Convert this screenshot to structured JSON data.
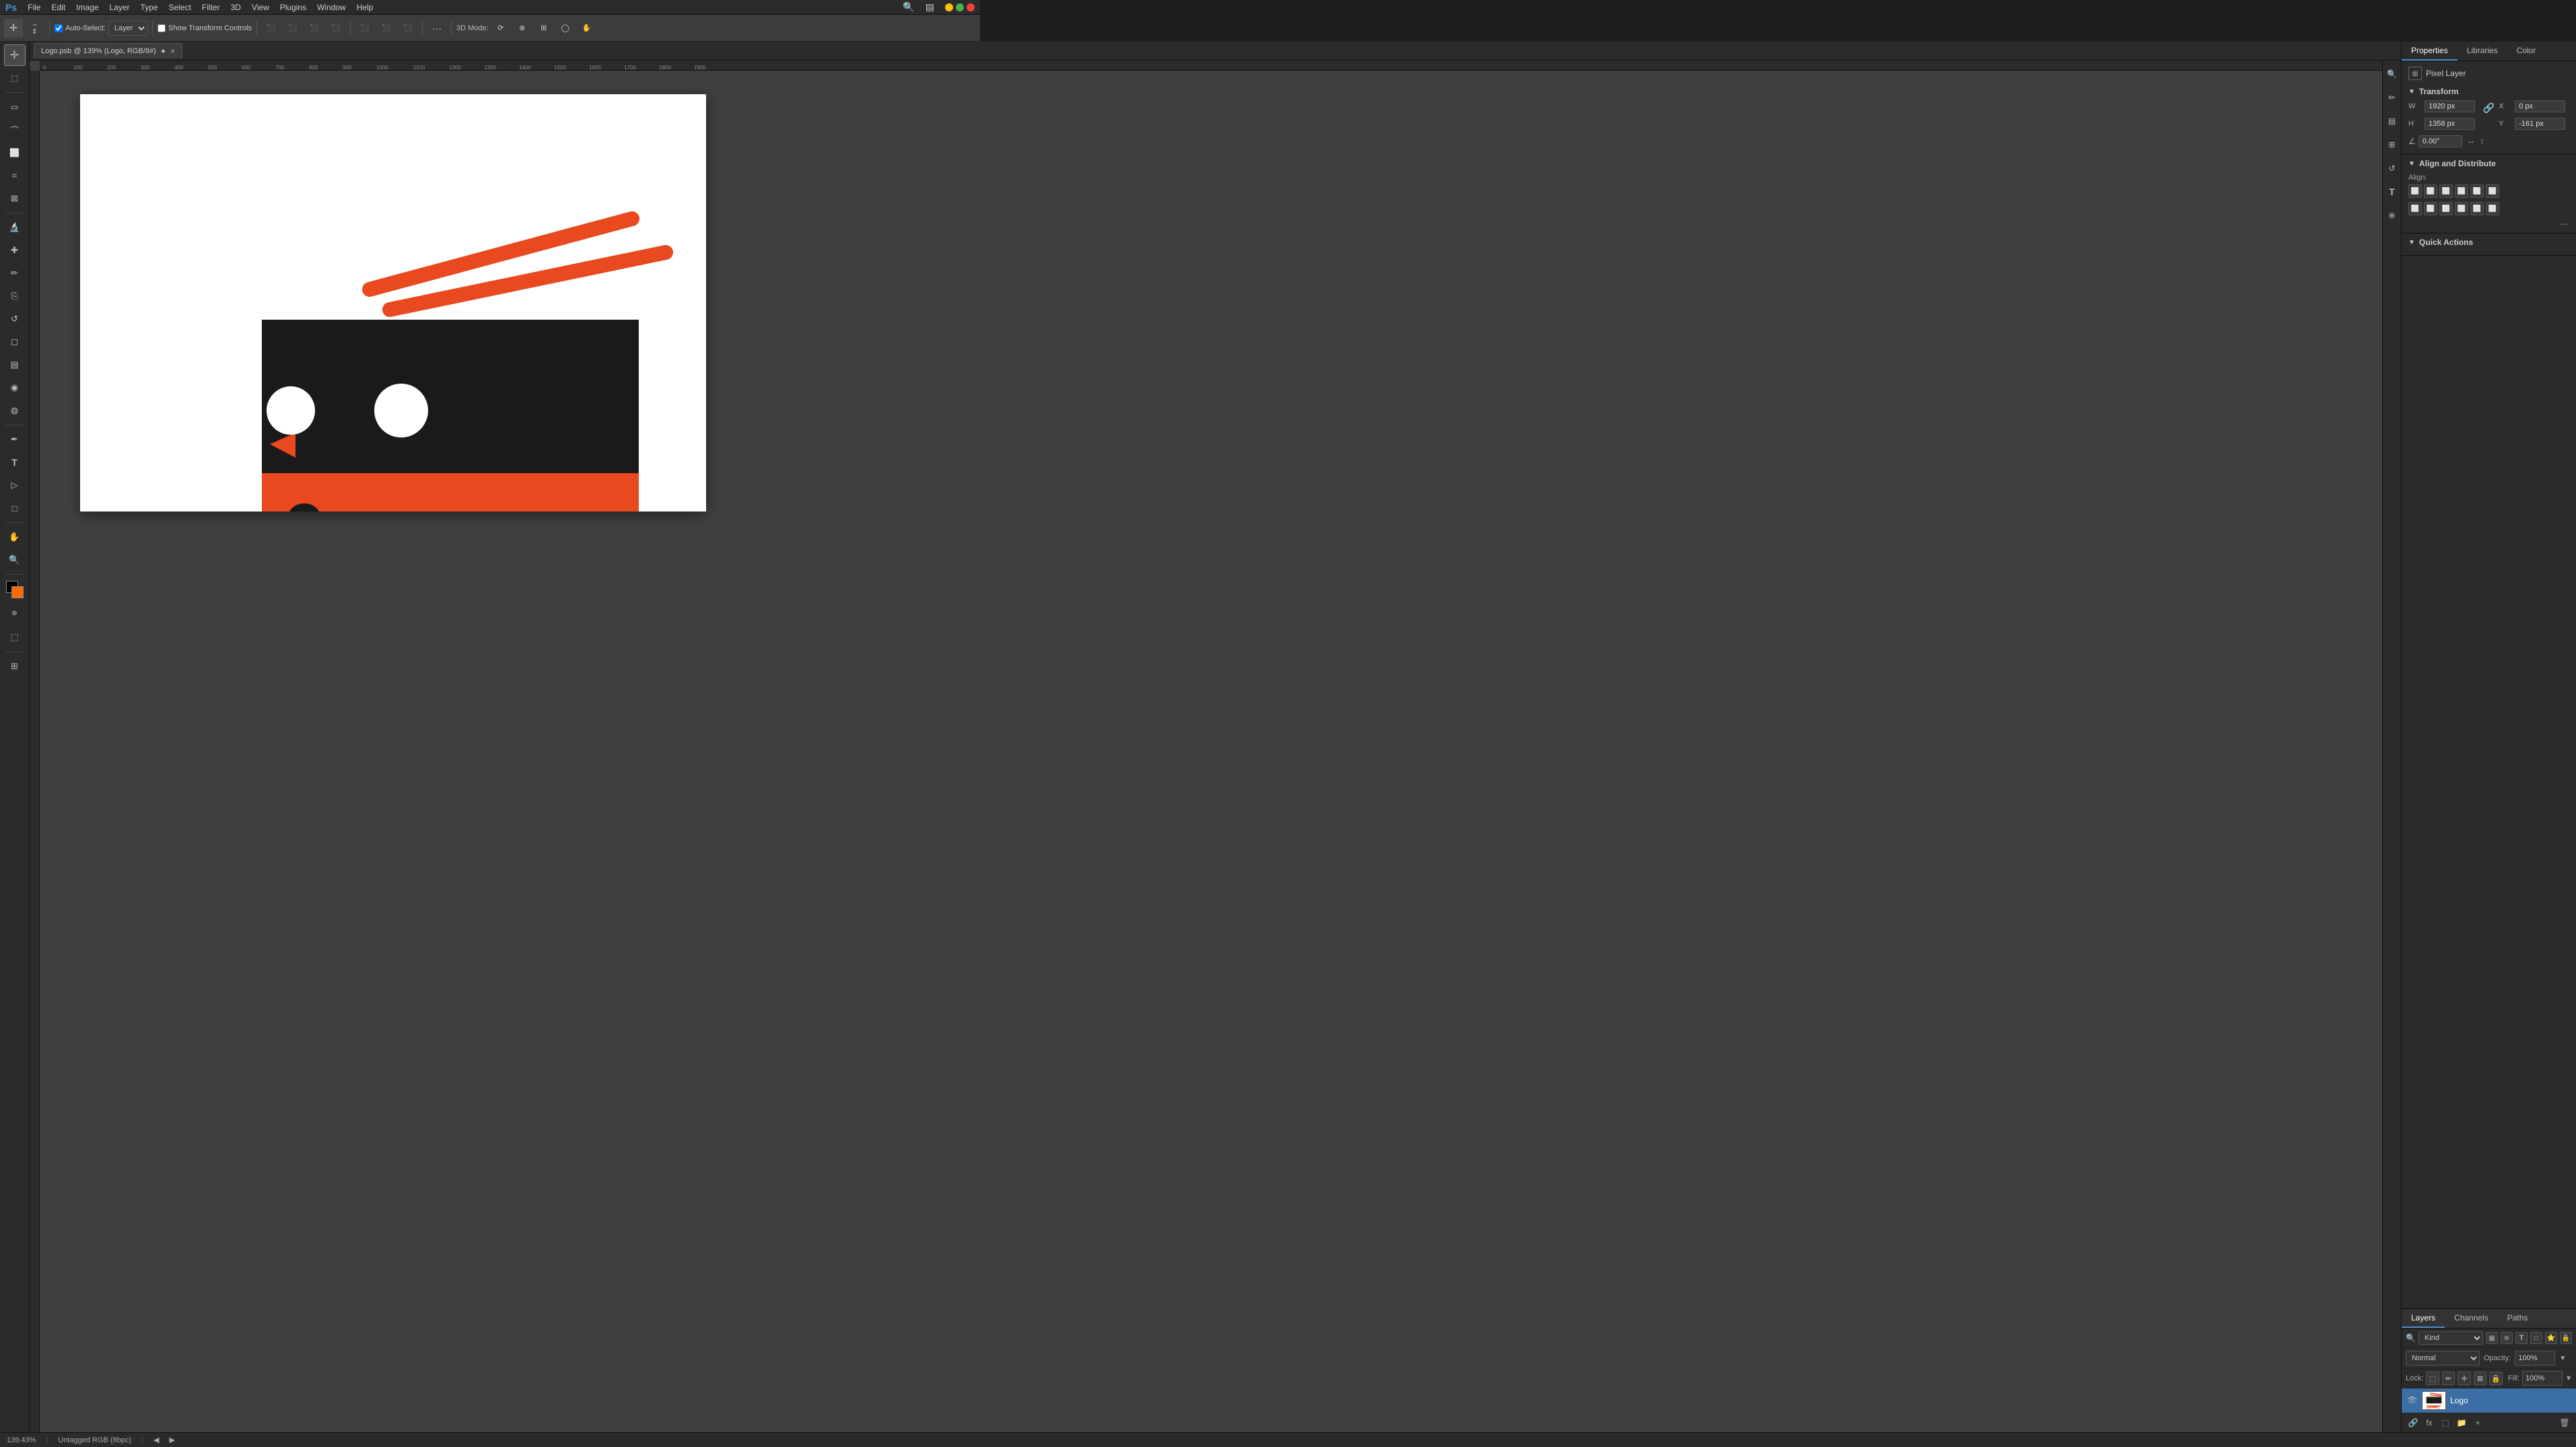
{
  "app": {
    "title": "Adobe Photoshop"
  },
  "menu": {
    "items": [
      "File",
      "Edit",
      "Image",
      "Layer",
      "Type",
      "Select",
      "Filter",
      "3D",
      "View",
      "Plugins",
      "Window",
      "Help"
    ]
  },
  "toolbar": {
    "auto_select_label": "Auto-Select:",
    "layer_label": "Layer",
    "show_transform_label": "Show Transform Controls",
    "align_icons": [
      "⬛",
      "⬛",
      "⬛",
      "⬛",
      "⬛",
      "⬛",
      "⬛",
      "⬛",
      "⬛"
    ],
    "more_btn": "···",
    "3d_mode_label": "3D Mode:"
  },
  "document_tab": {
    "title": "Logo.psb @ 139% (Logo, RGB/8#)",
    "modified": true
  },
  "properties_panel": {
    "title": "Properties",
    "tabs": [
      "Properties",
      "Libraries",
      "Color"
    ],
    "pixel_layer_label": "Pixel Layer",
    "transform": {
      "section": "Transform",
      "w_label": "W",
      "w_value": "1920 px",
      "x_label": "X",
      "x_value": "0 px",
      "h_label": "H",
      "h_value": "1358 px",
      "y_label": "Y",
      "y_value": "-161 px",
      "angle_value": "0.00°"
    },
    "align_distribute": {
      "section": "Align and Distribute",
      "align_label": "Align:"
    },
    "quick_actions": {
      "section": "Quick Actions",
      "more": "···"
    }
  },
  "layers_panel": {
    "tabs": [
      "Layers",
      "Channels",
      "Paths"
    ],
    "filter_kind": "Kind",
    "blend_mode": "Normal",
    "opacity_label": "Opacity:",
    "opacity_value": "100%",
    "lock_label": "Lock:",
    "fill_label": "Fill:",
    "fill_value": "100%",
    "layers": [
      {
        "name": "Logo",
        "visible": true,
        "selected": true
      }
    ]
  },
  "status_bar": {
    "zoom": "139.43%",
    "color_profile": "Untagged RGB (8bpc)"
  },
  "canvas": {
    "ruler_marks": [
      "0",
      "100",
      "200",
      "300",
      "400",
      "500",
      "600",
      "700",
      "800",
      "900",
      "1000",
      "1100",
      "1200",
      "1300",
      "1400",
      "1500",
      "1600",
      "1700",
      "1800",
      "1900"
    ]
  },
  "left_tools": [
    {
      "name": "move-tool",
      "icon": "✛",
      "label": "Move"
    },
    {
      "name": "select-tool",
      "icon": "⬚",
      "label": "Select"
    },
    {
      "name": "lasso-tool",
      "icon": "⌒",
      "label": "Lasso"
    },
    {
      "name": "magic-wand-tool",
      "icon": "✦",
      "label": "Magic Wand"
    },
    {
      "name": "crop-tool",
      "icon": "⊹",
      "label": "Crop"
    },
    {
      "name": "eyedropper-tool",
      "icon": "✎",
      "label": "Eyedropper"
    },
    {
      "name": "heal-tool",
      "icon": "✚",
      "label": "Heal"
    },
    {
      "name": "brush-tool",
      "icon": "✏",
      "label": "Brush"
    },
    {
      "name": "clone-tool",
      "icon": "✡",
      "label": "Clone"
    },
    {
      "name": "history-brush-tool",
      "icon": "↩",
      "label": "History Brush"
    },
    {
      "name": "eraser-tool",
      "icon": "⌫",
      "label": "Eraser"
    },
    {
      "name": "gradient-tool",
      "icon": "▦",
      "label": "Gradient"
    },
    {
      "name": "blur-tool",
      "icon": "◍",
      "label": "Blur"
    },
    {
      "name": "dodge-tool",
      "icon": "○",
      "label": "Dodge"
    },
    {
      "name": "pen-tool",
      "icon": "✒",
      "label": "Pen"
    },
    {
      "name": "type-tool",
      "icon": "T",
      "label": "Type"
    },
    {
      "name": "path-select-tool",
      "icon": "▶",
      "label": "Path Select"
    },
    {
      "name": "shape-tool",
      "icon": "□",
      "label": "Shape"
    },
    {
      "name": "hand-tool",
      "icon": "✋",
      "label": "Hand"
    },
    {
      "name": "zoom-tool",
      "icon": "🔍",
      "label": "Zoom"
    }
  ]
}
